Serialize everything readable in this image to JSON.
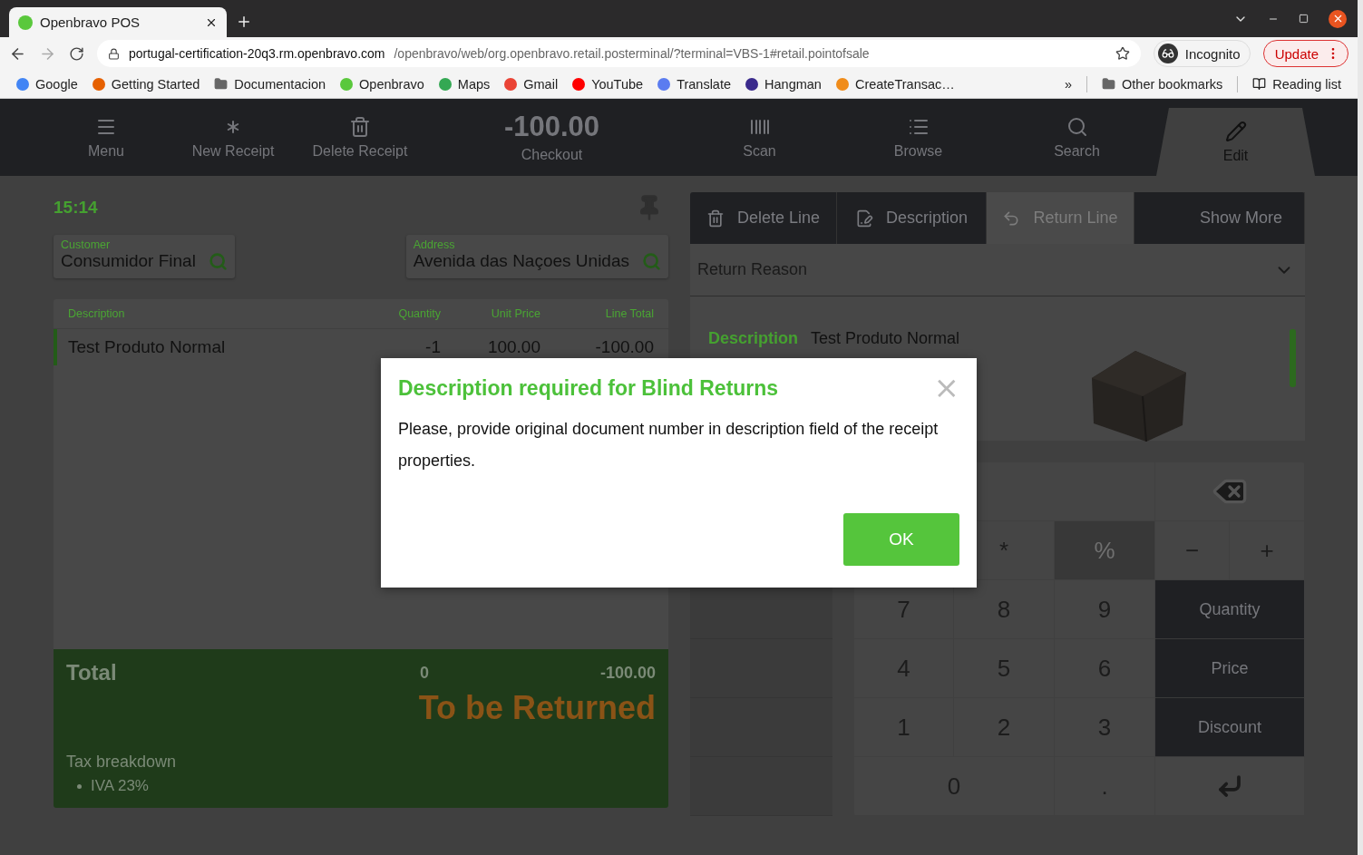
{
  "browser": {
    "tabs": [
      {
        "title": "Openbravo POS",
        "selected": true
      }
    ],
    "url": {
      "host": "portugal-certification-20q3.rm.openbravo.com",
      "path": "/openbravo/web/org.openbravo.retail.posterminal/?terminal=VBS-1#retail.pointofsale"
    },
    "incognito": "Incognito",
    "update": "Update",
    "bookmarks": [
      {
        "label": "Google",
        "kind": "site",
        "color": "#4285f4"
      },
      {
        "label": "Getting Started",
        "kind": "site",
        "color": "#e66000"
      },
      {
        "label": "Documentacion",
        "kind": "folder"
      },
      {
        "label": "Openbravo",
        "kind": "site",
        "color": "#5ac83c"
      },
      {
        "label": "Maps",
        "kind": "site",
        "color": "#34a853"
      },
      {
        "label": "Gmail",
        "kind": "site",
        "color": "#ea4335"
      },
      {
        "label": "YouTube",
        "kind": "site",
        "color": "#ff0000"
      },
      {
        "label": "Translate",
        "kind": "site",
        "color": "#5b7cf0"
      },
      {
        "label": "Hangman",
        "kind": "site",
        "color": "#3a2a8c"
      },
      {
        "label": "CreateTransac…",
        "kind": "site",
        "color": "#f08c1a"
      }
    ],
    "overflow": "»",
    "other_bookmarks": "Other bookmarks",
    "reading_list": "Reading list"
  },
  "toolbar": [
    {
      "label": "Menu",
      "kind": "menu",
      "selected": false
    },
    {
      "label": "New Receipt",
      "kind": "new",
      "selected": false
    },
    {
      "label": "Delete Receipt",
      "kind": "delete",
      "selected": false
    },
    {
      "label": "Checkout",
      "kind": "checkout",
      "amount": "-100.00",
      "selected": false
    },
    {
      "label": "Scan",
      "kind": "scan",
      "selected": false
    },
    {
      "label": "Browse",
      "kind": "browse",
      "selected": false
    },
    {
      "label": "Search",
      "kind": "search",
      "selected": false
    },
    {
      "label": "Edit",
      "kind": "edit",
      "selected": true
    }
  ],
  "receipt": {
    "time": "15:14",
    "customer": {
      "label": "Customer",
      "value": "Consumidor Final"
    },
    "address": {
      "label": "Address",
      "value": "Avenida das Naçoes Unidas"
    },
    "columns": [
      "Description",
      "Quantity",
      "Unit Price",
      "Line Total"
    ],
    "rows": [
      {
        "cells": [
          "Test Produto Normal",
          "-1",
          "100.00",
          "-100.00"
        ],
        "selected": true
      }
    ],
    "total": {
      "label": "Total",
      "quantity": "0",
      "amount": "-100.00"
    },
    "status": "To be Returned",
    "tax_breakdown": {
      "title": "Tax breakdown",
      "items": [
        "IVA 23%"
      ]
    }
  },
  "edit": {
    "actions": [
      {
        "label": "Delete Line",
        "kind": "delete",
        "disabled": false
      },
      {
        "label": "Description",
        "kind": "description",
        "disabled": false
      },
      {
        "label": "Return Line",
        "kind": "return",
        "disabled": true
      },
      {
        "label": "Show More",
        "kind": "more",
        "disabled": false
      }
    ],
    "return_reason": {
      "placeholder": "Return Reason"
    },
    "details": [
      {
        "label": "Description",
        "value": "Test Produto Normal"
      }
    ]
  },
  "keypad": [
    {
      "kind": "display"
    },
    {
      "kind": "backspace"
    },
    {
      "kind": "blank"
    },
    {
      "kind": "key",
      "label": "*"
    },
    {
      "kind": "dim",
      "label": "%"
    },
    {
      "kind": "key",
      "label": "−"
    },
    {
      "kind": "key",
      "label": "+"
    },
    {
      "kind": "key",
      "label": "7"
    },
    {
      "kind": "key",
      "label": "8"
    },
    {
      "kind": "key",
      "label": "9"
    },
    {
      "kind": "action",
      "label": "Quantity"
    },
    {
      "kind": "key",
      "label": "4"
    },
    {
      "kind": "key",
      "label": "5"
    },
    {
      "kind": "key",
      "label": "6"
    },
    {
      "kind": "action",
      "label": "Price"
    },
    {
      "kind": "key",
      "label": "1"
    },
    {
      "kind": "key",
      "label": "2"
    },
    {
      "kind": "key",
      "label": "3"
    },
    {
      "kind": "action",
      "label": "Discount"
    },
    {
      "kind": "wide",
      "label": "0"
    },
    {
      "kind": "key",
      "label": "."
    },
    {
      "kind": "enter"
    }
  ],
  "dialog": {
    "title": "Description required for Blind Returns",
    "message": "Please, provide original document number in description field of the receipt properties.",
    "close": "×",
    "button": "OK"
  }
}
